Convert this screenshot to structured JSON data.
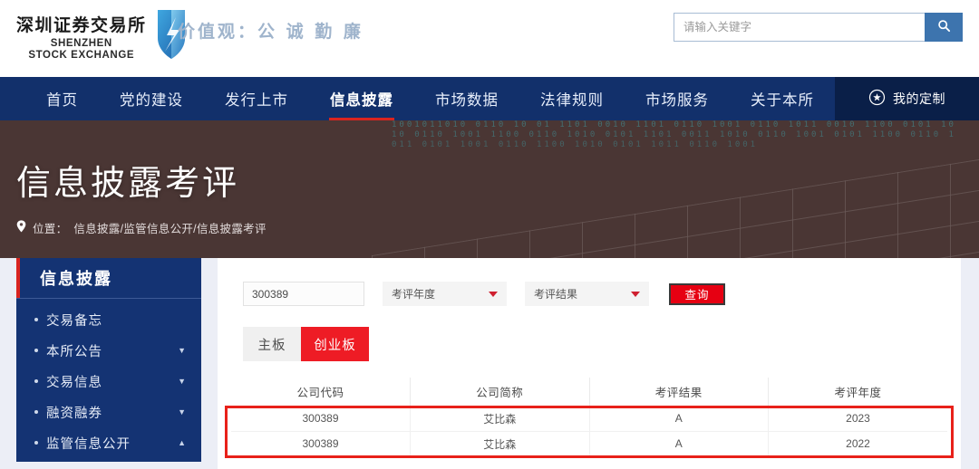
{
  "header": {
    "logo_cn": "深圳证券交易所",
    "logo_en_line1": "SHENZHEN",
    "logo_en_line2": "STOCK EXCHANGE",
    "slogan": "价值观：公 诚 勤 廉",
    "search_placeholder": "请输入关键字",
    "search_value": "",
    "search_icon": "search-icon"
  },
  "nav": {
    "items": [
      {
        "label": "首页",
        "active": false
      },
      {
        "label": "党的建设",
        "active": false
      },
      {
        "label": "发行上市",
        "active": false
      },
      {
        "label": "信息披露",
        "active": true
      },
      {
        "label": "市场数据",
        "active": false
      },
      {
        "label": "法律规则",
        "active": false
      },
      {
        "label": "市场服务",
        "active": false
      },
      {
        "label": "关于本所",
        "active": false
      }
    ],
    "custom_label": "我的定制",
    "custom_icon": "star-circle-icon",
    "active_underline_color": "#d9241f",
    "background_color": "#12306b"
  },
  "banner": {
    "title": "信息披露考评",
    "breadcrumb_prefix": "位置：",
    "breadcrumb_path": "信息披露/监管信息公开/信息披露考评",
    "pin_icon": "location-pin-icon",
    "code_text": "1001011010 0110 10 01 1101 0010 1101 0110 1001 0110 1011 0010 1100 0101 1010 0110 1001 1100 0110 1010 0101 1101 0011 1010 0110 1001 0101 1100 0110 1011 0101 1001 0110 1100 1010 0101 1011 0110 1001"
  },
  "sidebar": {
    "title": "信息披露",
    "accent_color": "#d9241f",
    "items": [
      {
        "label": "交易备忘",
        "caret": ""
      },
      {
        "label": "本所公告",
        "caret": "▼"
      },
      {
        "label": "交易信息",
        "caret": "▼"
      },
      {
        "label": "融资融券",
        "caret": "▼"
      },
      {
        "label": "监管信息公开",
        "caret": "▲"
      }
    ]
  },
  "filters": {
    "code_value": "300389",
    "code_placeholder": "",
    "year_select_label": "考评年度",
    "result_select_label": "考评结果",
    "query_button": "查询",
    "query_button_color": "#e60012"
  },
  "tabs": [
    {
      "label": "主板",
      "active": false
    },
    {
      "label": "创业板",
      "active": true
    }
  ],
  "table": {
    "columns": [
      "公司代码",
      "公司简称",
      "考评结果",
      "考评年度"
    ],
    "rows": [
      [
        "300389",
        "艾比森",
        "A",
        "2023"
      ],
      [
        "300389",
        "艾比森",
        "A",
        "2022"
      ]
    ],
    "highlight_color": "#e8211a"
  }
}
